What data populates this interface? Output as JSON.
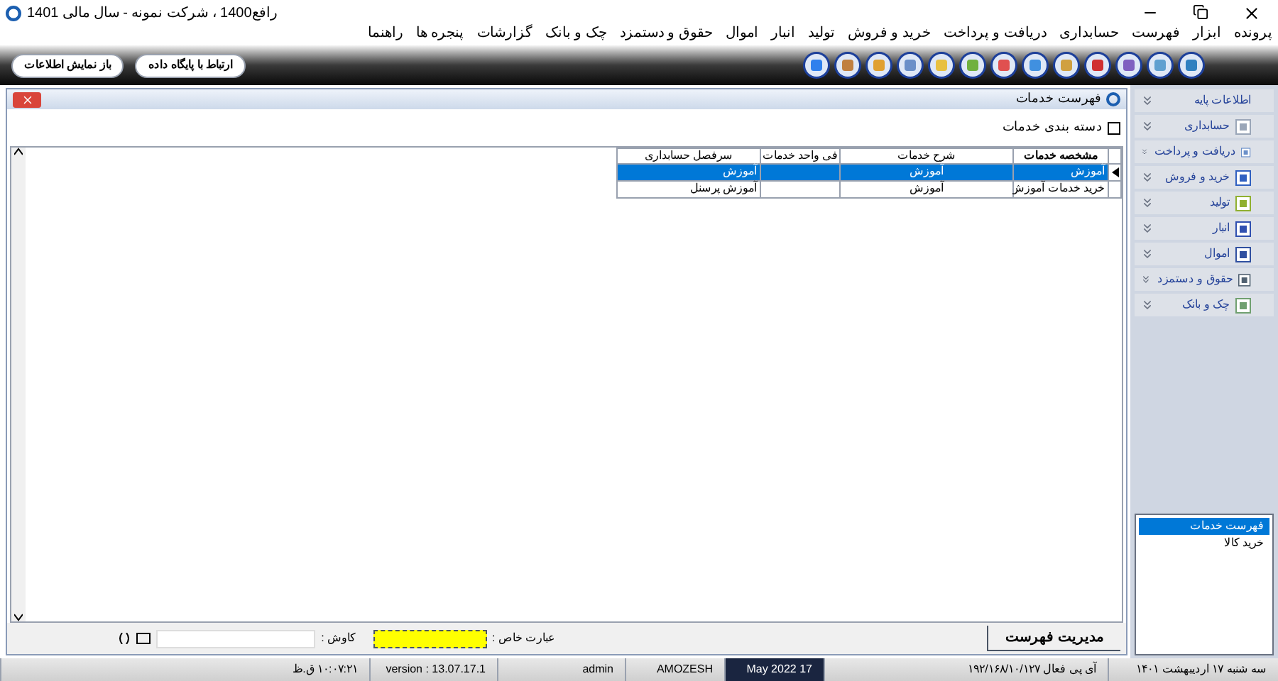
{
  "window": {
    "title": "رافع1400 ، شرکت نمونه - سال مالی 1401"
  },
  "menu": [
    "پرونده",
    "ابزار",
    "فهرست",
    "حسابداری",
    "دریافت و پرداخت",
    "خرید و فروش",
    "تولید",
    "انبار",
    "اموال",
    "حقوق و دستمزد",
    "چک و بانک",
    "گزارشات",
    "پنجره ها",
    "راهنما"
  ],
  "toolbar_buttons": [
    "ارتباط با پایگاه داده",
    "باز نمایش اطلاعات"
  ],
  "child_window": {
    "title": "فهرست خدمات"
  },
  "group_checkbox": {
    "label": "دسته بندی خدمات",
    "checked": false
  },
  "table": {
    "columns": [
      "مشخصه خدمات",
      "شرح خدمات",
      "فی واحد خدمات",
      "سرفصل حسابداری"
    ],
    "rows": [
      {
        "selected": true,
        "cells": [
          "آموزش",
          "آموزش",
          "",
          "آموزش"
        ]
      },
      {
        "selected": false,
        "cells": [
          "خرید خدمات آموزش",
          "آموزش",
          "",
          "آموزش پرسنل"
        ]
      }
    ]
  },
  "bottom_bar": {
    "manage_button": "مدیریت فهرست",
    "special_label": "عبارت خاص :",
    "search_label": "کاوش :"
  },
  "sidebar": {
    "items": [
      "اطلاعات پایه",
      "حسابداری",
      "دریافت و پرداخت",
      "خرید و فروش",
      "تولید",
      "انبار",
      "اموال",
      "حقوق و دستمزد",
      "چک و بانک"
    ]
  },
  "window_list": [
    {
      "label": "فهرست خدمات",
      "selected": true
    },
    {
      "label": "خرید کالا",
      "selected": false
    }
  ],
  "status_bar": [
    "سه شنبه ۱۷ اردیبهشت ۱۴۰۱",
    "آی پی فعال ۱۹۲/۱۶۸/۱۰/۱۲۷",
    "17 May 2022",
    "AMOZESH",
    "admin",
    "version : 13.07.17.1",
    "۱۰:۰۷:۲۱ ق.ظ"
  ]
}
